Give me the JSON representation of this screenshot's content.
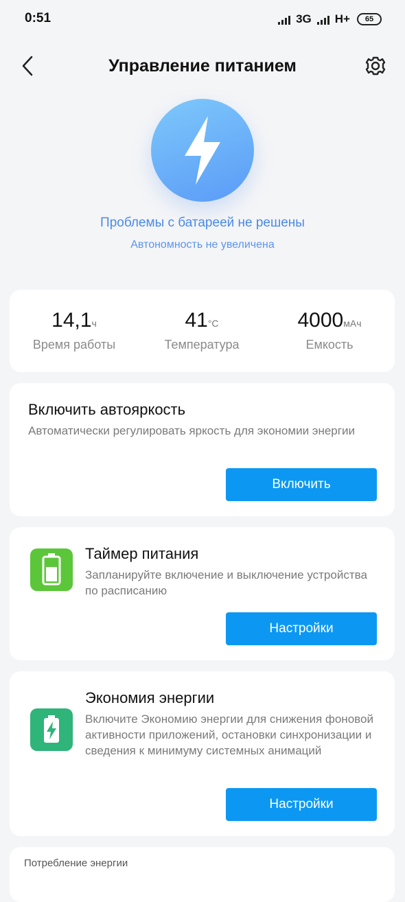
{
  "status_bar": {
    "time": "0:51",
    "network1": "3G",
    "network2": "H+",
    "battery": "65"
  },
  "header": {
    "title": "Управление питанием",
    "back_icon": "chevron-left-icon",
    "settings_icon": "gear-icon"
  },
  "hero": {
    "icon": "lightning-icon",
    "title": "Проблемы с батареей не решены",
    "subtitle": "Автономность не увеличена"
  },
  "stats": [
    {
      "value": "14,1",
      "unit": "ч",
      "label": "Время работы"
    },
    {
      "value": "41",
      "unit": "°C",
      "label": "Температура"
    },
    {
      "value": "4000",
      "unit": "мАч",
      "label": "Емкость"
    }
  ],
  "cards": {
    "auto_brightness": {
      "title": "Включить автояркость",
      "description": "Автоматически регулировать яркость для экономии энергии",
      "button": "Включить"
    },
    "power_timer": {
      "title": "Таймер питания",
      "description": "Запланируйте включение и выключение устройства по расписанию",
      "button": "Настройки",
      "icon": "battery-timer-icon",
      "icon_color": "#5cc63a"
    },
    "power_saving": {
      "title": "Экономия энергии",
      "description": "Включите Экономию энергии для снижения фоновой активности приложений, остановки синхронизации и сведения к минимуму системных анимаций",
      "button": "Настройки",
      "icon": "battery-saver-icon",
      "icon_color": "#2fb47a"
    }
  },
  "consumption": {
    "label": "Потребление энергии"
  },
  "colors": {
    "accent": "#0c98f2",
    "hero_text": "#4a8ae8"
  }
}
